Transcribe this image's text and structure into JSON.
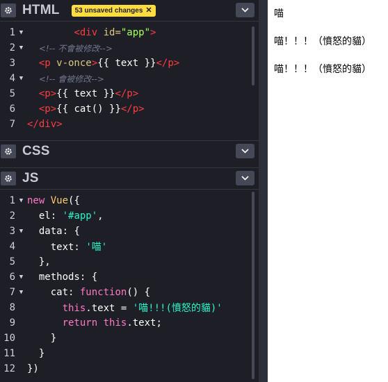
{
  "panels": {
    "html": {
      "title": "HTML",
      "unsaved_badge": "53 unsaved changes",
      "lines": [
        {
          "n": "1",
          "fold": true
        },
        {
          "n": "2",
          "fold": true
        },
        {
          "n": "3",
          "fold": false
        },
        {
          "n": "4",
          "fold": true
        },
        {
          "n": "5",
          "fold": false
        },
        {
          "n": "6",
          "fold": false
        },
        {
          "n": "7",
          "fold": false
        }
      ]
    },
    "css": {
      "title": "CSS"
    },
    "js": {
      "title": "JS",
      "lines": [
        {
          "n": "1",
          "fold": true
        },
        {
          "n": "2",
          "fold": false
        },
        {
          "n": "3",
          "fold": true
        },
        {
          "n": "4",
          "fold": false
        },
        {
          "n": "5",
          "fold": false
        },
        {
          "n": "6",
          "fold": true
        },
        {
          "n": "7",
          "fold": true
        },
        {
          "n": "8",
          "fold": false
        },
        {
          "n": "9",
          "fold": false
        },
        {
          "n": "10",
          "fold": false
        },
        {
          "n": "11",
          "fold": false
        },
        {
          "n": "12",
          "fold": false
        }
      ]
    }
  },
  "html_code": {
    "l1": {
      "open": "<div",
      "attr": " id=",
      "val": "\"app\"",
      "close": ">"
    },
    "l2": {
      "indent": "  ",
      "comment": "<!-- 不會被修改-->"
    },
    "l3": {
      "indent": "  ",
      "open": "<p",
      "attr": " v-once",
      "close": ">",
      "text": "{{ text }}",
      "end": "</p>"
    },
    "l4": {
      "indent": "  ",
      "comment": "<!-- 會被修改-->"
    },
    "l5": {
      "indent": "  ",
      "open": "<p>",
      "text": "{{ text }}",
      "end": "</p>"
    },
    "l6": {
      "indent": "  ",
      "open": "<p>",
      "text": "{{ cat() }}",
      "end": "</p>"
    },
    "l7": {
      "end": "</div>"
    }
  },
  "js_code": {
    "l1": {
      "kw": "new",
      "cls": " Vue",
      "rest": "({"
    },
    "l2": {
      "indent": "  ",
      "prop": "el:",
      "sp": " ",
      "str": "'#app'",
      "rest": ","
    },
    "l3": {
      "indent": "  ",
      "prop": "data:",
      "rest": " {"
    },
    "l4": {
      "indent": "    ",
      "prop": "text:",
      "sp": " ",
      "str": "'喵'"
    },
    "l5": {
      "indent": "  ",
      "rest": "},"
    },
    "l6": {
      "indent": "  ",
      "prop": "methods:",
      "rest": " {"
    },
    "l7": {
      "indent": "    ",
      "prop": "cat:",
      "sp": " ",
      "kw": "function",
      "rest": "() {"
    },
    "l8": {
      "indent": "      ",
      "this": "this",
      "rest": ".text = ",
      "str": "'喵!!!(憤怒的貓)'"
    },
    "l9": {
      "indent": "      ",
      "kw": "return",
      "sp": " ",
      "this": "this",
      "rest": ".text;"
    },
    "l10": {
      "indent": "    ",
      "rest": "}"
    },
    "l11": {
      "indent": "  ",
      "rest": "}"
    },
    "l12": {
      "rest": "})"
    }
  },
  "preview": {
    "lines": [
      "喵",
      "喵！！！（憤怒的貓）",
      "喵！！！（憤怒的貓）"
    ]
  },
  "colors": {
    "editor_bg": "#1e1f26",
    "badge": "#ffdd40",
    "tag": "#ff3c41",
    "string_js": "#2bf5c9"
  }
}
